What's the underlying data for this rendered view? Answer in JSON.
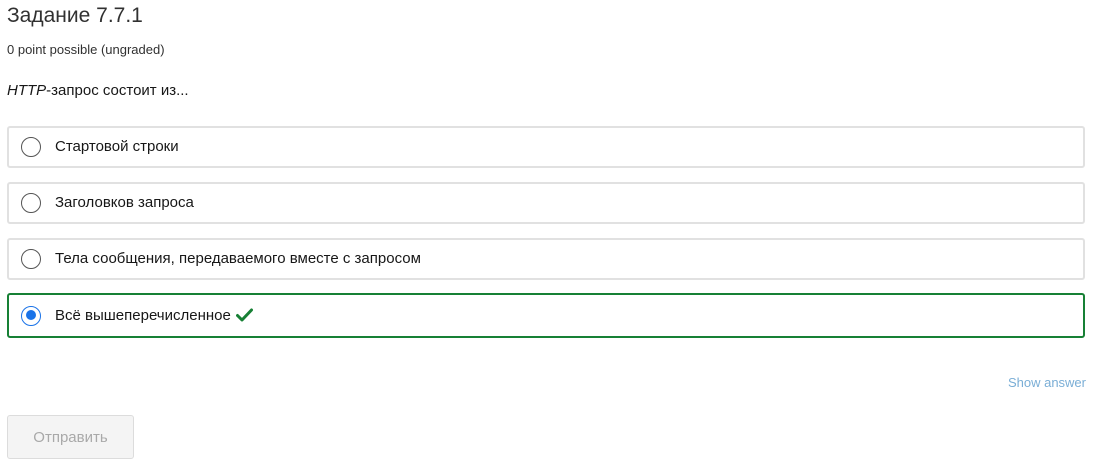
{
  "problem": {
    "title": "Задание 7.7.1",
    "points": "0 point possible (ungraded)",
    "question_em": "HTTP",
    "question_rest": "-запрос состоит из..."
  },
  "choices": [
    {
      "label": "Стартовой строки",
      "checked": false
    },
    {
      "label": "Заголовков запроса",
      "checked": false
    },
    {
      "label": "Тела сообщения, передаваемого вместе с запросом",
      "checked": false
    },
    {
      "label": "Всё вышеперечисленное",
      "checked": true,
      "status": "correct"
    }
  ],
  "icons": {
    "correct": "checkmark-icon"
  },
  "colors": {
    "correct": "#178035",
    "selected_radio": "#1a73e8",
    "link": "#7aaed6"
  },
  "actions": {
    "show_answer": "Show answer",
    "submit": "Отправить"
  }
}
